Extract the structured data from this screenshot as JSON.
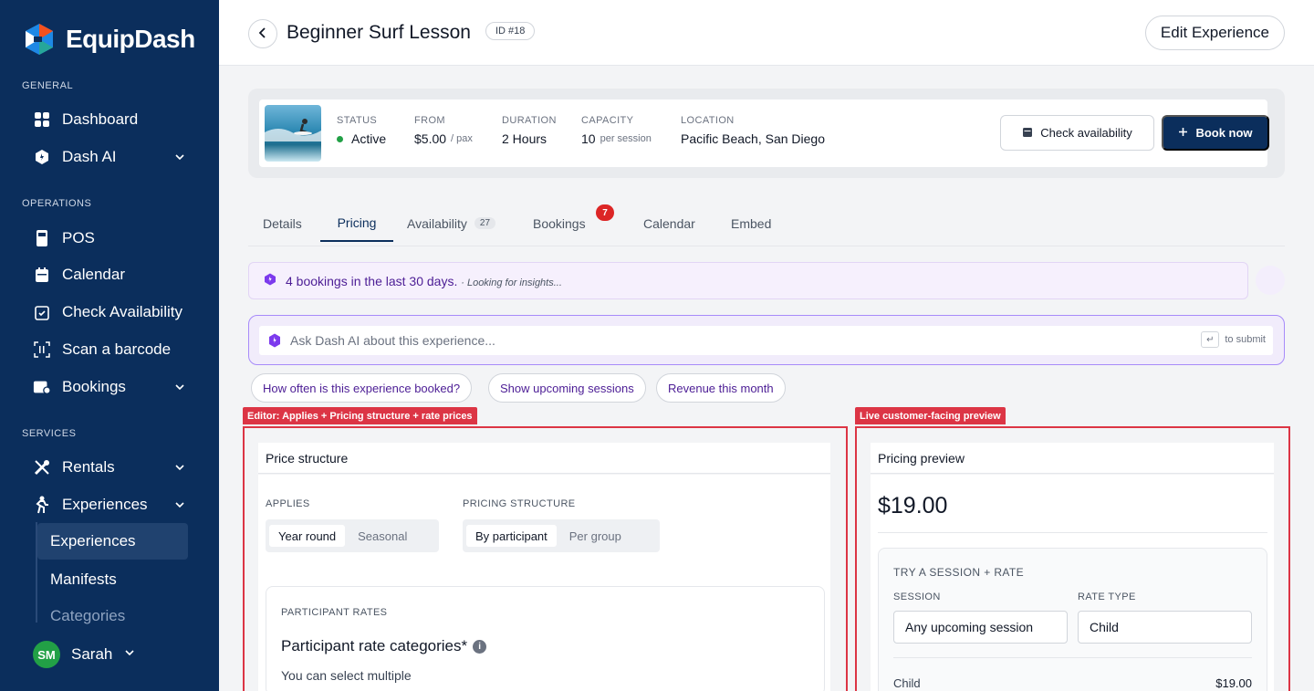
{
  "brand": {
    "name": "EquipDash"
  },
  "sidebar": {
    "sections": {
      "general": "GENERAL",
      "operations": "OPERATIONS",
      "services": "SERVICES"
    },
    "items": {
      "dashboard": "Dashboard",
      "dash_ai": "Dash AI",
      "pos": "POS",
      "calendar": "Calendar",
      "check_availability": "Check Availability",
      "scan_barcode": "Scan a barcode",
      "bookings": "Bookings",
      "rentals": "Rentals",
      "experiences": "Experiences"
    },
    "sub_items": {
      "experiences": "Experiences",
      "manifests": "Manifests",
      "categories": "Categories"
    },
    "user": {
      "initials": "SM",
      "name": "Sarah"
    }
  },
  "header": {
    "title": "Beginner Surf Lesson",
    "id_badge": "ID #18",
    "edit_label": "Edit Experience"
  },
  "summary": {
    "status_label": "STATUS",
    "status_value": "Active",
    "from_label": "FROM",
    "from_value": "$5.00",
    "from_unit": "/ pax",
    "duration_label": "DURATION",
    "duration_value": "2 Hours",
    "capacity_label": "CAPACITY",
    "capacity_value": "10",
    "capacity_unit": "per session",
    "location_label": "LOCATION",
    "location_value": "Pacific Beach, San Diego",
    "check_label": "Check availability",
    "book_label": "Book now",
    "status_color": "#22a046"
  },
  "tabs": {
    "details": "Details",
    "pricing": "Pricing",
    "availability": "Availability",
    "availability_count": "27",
    "bookings": "Bookings",
    "bookings_badge": "7",
    "calendar": "Calendar",
    "embed": "Embed"
  },
  "insight": {
    "text": "4 bookings in the last 30 days.",
    "hint": "· Looking for insights..."
  },
  "ask": {
    "placeholder": "Ask Dash AI about this experience...",
    "submit_key": "↵",
    "submit_hint": "to submit"
  },
  "chips": [
    "How often is this experience booked?",
    "Show upcoming sessions",
    "Revenue this month"
  ],
  "annotations": {
    "editor": "Editor: Applies + Pricing structure + rate prices",
    "preview": "Live customer-facing preview"
  },
  "editor": {
    "title": "Price structure",
    "applies_label": "APPLIES",
    "applies_options": [
      "Year round",
      "Seasonal"
    ],
    "structure_label": "PRICING STRUCTURE",
    "structure_options": [
      "By participant",
      "Per group"
    ],
    "rates_label": "PARTICIPANT RATES",
    "rates_title": "Participant rate categories*",
    "rates_sub": "You can select multiple"
  },
  "preview": {
    "title": "Pricing preview",
    "price": "$19.00",
    "try_label": "TRY A SESSION + RATE",
    "session_label": "SESSION",
    "session_value": "Any upcoming session",
    "rate_label": "RATE TYPE",
    "rate_value": "Child",
    "line_label": "Child",
    "line_value": "$19.00"
  },
  "colors": {
    "sidebar": "#0b2e5c",
    "accent": "#0b2e5c",
    "annotation": "#dc3545",
    "ai": "#4c1d95"
  }
}
